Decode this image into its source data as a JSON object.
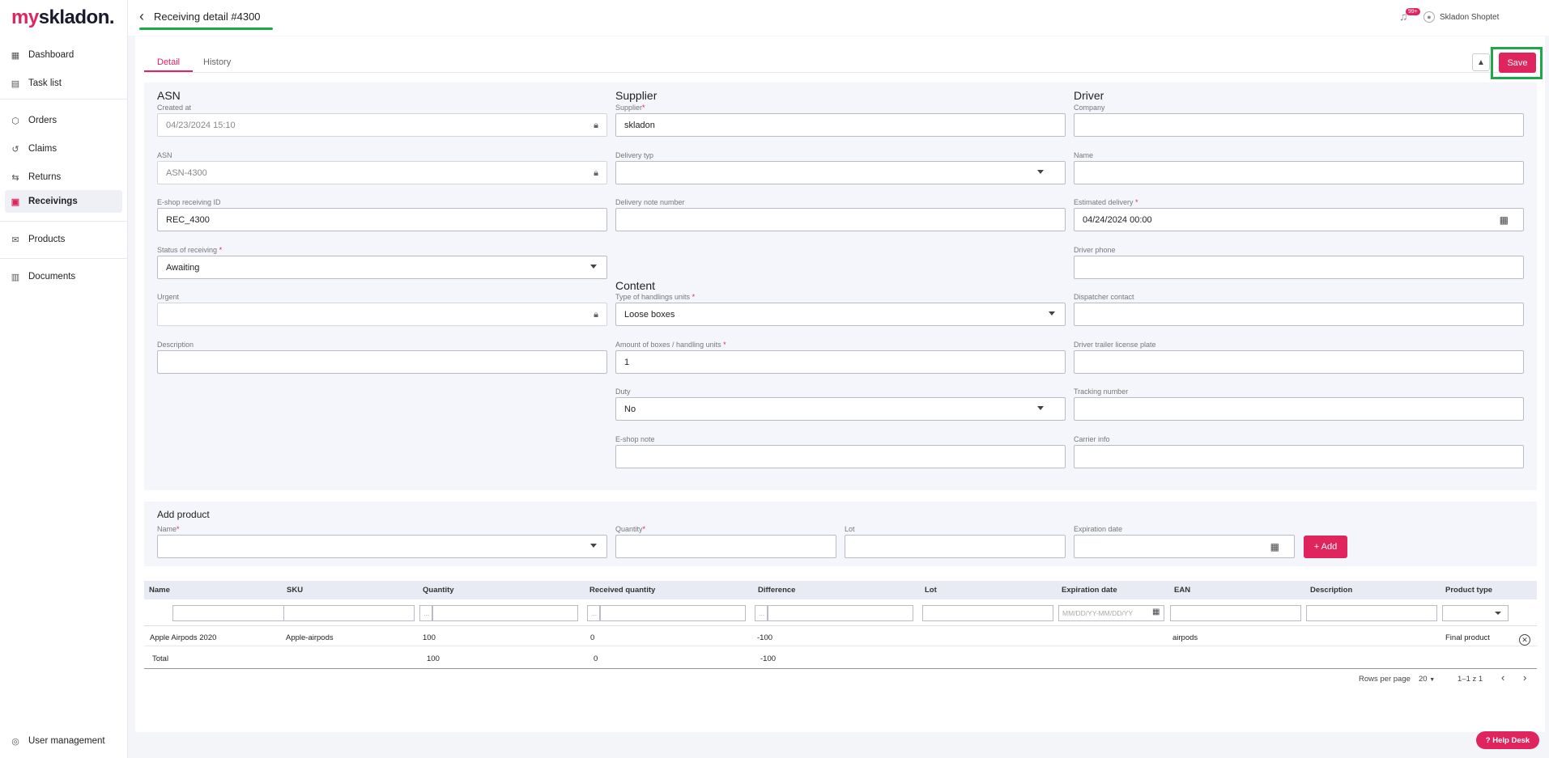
{
  "brand": {
    "logo_prefix": "my",
    "logo_suffix": "skladon."
  },
  "sidebar": {
    "items": [
      {
        "label": "Dashboard",
        "icon": "dashboard-icon"
      },
      {
        "label": "Task list",
        "icon": "task-list-icon"
      },
      {
        "label": "Orders",
        "icon": "orders-icon"
      },
      {
        "label": "Claims",
        "icon": "claims-icon"
      },
      {
        "label": "Returns",
        "icon": "returns-icon"
      },
      {
        "label": "Receivings",
        "icon": "receivings-icon",
        "active": true
      },
      {
        "label": "Products",
        "icon": "products-icon"
      },
      {
        "label": "Documents",
        "icon": "documents-icon"
      }
    ],
    "footer": "User management"
  },
  "header": {
    "title": "Receiving detail #4300",
    "notification_badge": "99+",
    "user": "Skladon Shoptet"
  },
  "tabs": [
    "Detail",
    "History"
  ],
  "toolbar": {
    "save_label": "Save"
  },
  "asn": {
    "title": "ASN",
    "created_at_label": "Created at",
    "created_at": "04/23/2024 15:10",
    "asn_label": "ASN",
    "asn": "ASN-4300",
    "eshop_id_label": "E-shop receiving ID",
    "eshop_id": "REC_4300",
    "status_label": "Status of receiving",
    "status": "Awaiting",
    "urgent_label": "Urgent",
    "description_label": "Description"
  },
  "supplier": {
    "title": "Supplier",
    "supplier_label": "Supplier",
    "supplier": "skladon",
    "delivery_type_label": "Delivery typ",
    "delivery_note_label": "Delivery note number"
  },
  "content": {
    "title": "Content",
    "handling_label": "Type of handlings units",
    "handling": "Loose boxes",
    "amount_label": "Amount of boxes / handling units",
    "amount": "1",
    "duty_label": "Duty",
    "duty": "No",
    "eshop_note_label": "E-shop note"
  },
  "driver": {
    "title": "Driver",
    "company_label": "Company",
    "name_label": "Name",
    "estimated_label": "Estimated delivery",
    "estimated": "04/24/2024 00:00",
    "phone_label": "Driver phone",
    "dispatcher_label": "Dispatcher contact",
    "trailer_label": "Driver trailer license plate",
    "tracking_label": "Tracking number",
    "carrier_label": "Carrier info"
  },
  "add_product": {
    "title": "Add product",
    "name_label": "Name",
    "quantity_label": "Quantity",
    "lot_label": "Lot",
    "expiration_label": "Expiration date",
    "add_label": "+ Add"
  },
  "table": {
    "columns": [
      "Name",
      "SKU",
      "Quantity",
      "Received quantity",
      "Difference",
      "Lot",
      "Expiration date",
      "EAN",
      "Description",
      "Product type"
    ],
    "date_placeholder": "MM/DD/YY-MM/DD/YY",
    "range_prefix": "...",
    "rows": [
      {
        "name": "Apple Airpods 2020",
        "sku": "Apple-airpods",
        "quantity": "100",
        "received": "0",
        "difference": "-100",
        "lot": "",
        "expiration": "",
        "ean": "airpods",
        "description": "",
        "product_type": "Final product"
      }
    ],
    "total": {
      "label": "Total",
      "quantity": "100",
      "received": "0",
      "difference": "-100"
    }
  },
  "pagination": {
    "rows_per_page_label": "Rows per page",
    "rows_per_page": "20",
    "range": "1–1 z 1"
  },
  "help": {
    "label": "Help Desk"
  },
  "colors": {
    "accent": "#e0245e",
    "highlight": "#1ea84a"
  }
}
